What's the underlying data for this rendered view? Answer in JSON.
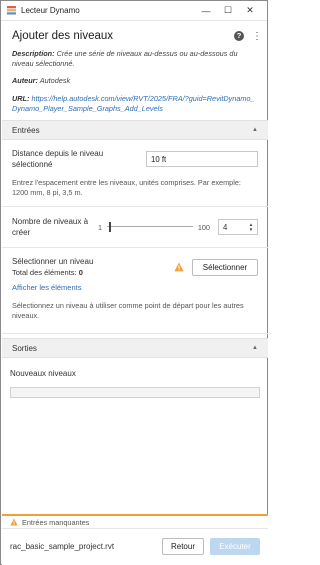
{
  "window": {
    "title": "Lecteur Dynamo",
    "minimize": "—",
    "maximize": "☐",
    "close": "✕"
  },
  "header": {
    "title": "Ajouter des niveaux",
    "help_label": "?",
    "menu_label": "⋮",
    "description_label": "Description:",
    "description_text": "Crée une série de niveaux au-dessus ou au-dessous du niveau sélectionné.",
    "author_label": "Auteur:",
    "author_text": "Autodesk",
    "url_label": "URL:",
    "url_text": "https://help.autodesk.com/view/RVT/2025/FRA/?guid=RevitDynamo_Dynamo_Player_Sample_Graphs_Add_Levels"
  },
  "inputs_section": {
    "title": "Entrées",
    "distance": {
      "label": "Distance depuis le niveau sélectionné",
      "value": "10 ft",
      "hint": "Entrez l'espacement entre les niveaux, unités comprises. Par exemple: 1200 mm, 8 pi, 3,5 m."
    },
    "count": {
      "label": "Nombre de niveaux à créer",
      "min": "1",
      "max": "100",
      "value": "4",
      "fraction": 0.03
    },
    "level_select": {
      "label": "Sélectionner un niveau",
      "total_label": "Total des éléments:",
      "total_value": "0",
      "show_link": "Afficher les éléments",
      "button": "Sélectionner",
      "hint": "Sélectionnez un niveau à utiliser comme point de départ pour les autres niveaux."
    }
  },
  "outputs_section": {
    "title": "Sorties",
    "new_levels_label": "Nouveaux niveaux"
  },
  "footer": {
    "warning": "Entrées manquantes",
    "file_name": "rac_basic_sample_project.rvt",
    "back_button": "Retour",
    "run_button": "Exécuter"
  },
  "colors": {
    "accent": "#2e6db3",
    "warning": "#f0a038",
    "run_button_disabled": "#bcd7ef"
  },
  "icons": [
    "dynamo-app-icon",
    "help-icon",
    "kebab-menu-icon",
    "chevron-up-icon",
    "warning-icon"
  ]
}
